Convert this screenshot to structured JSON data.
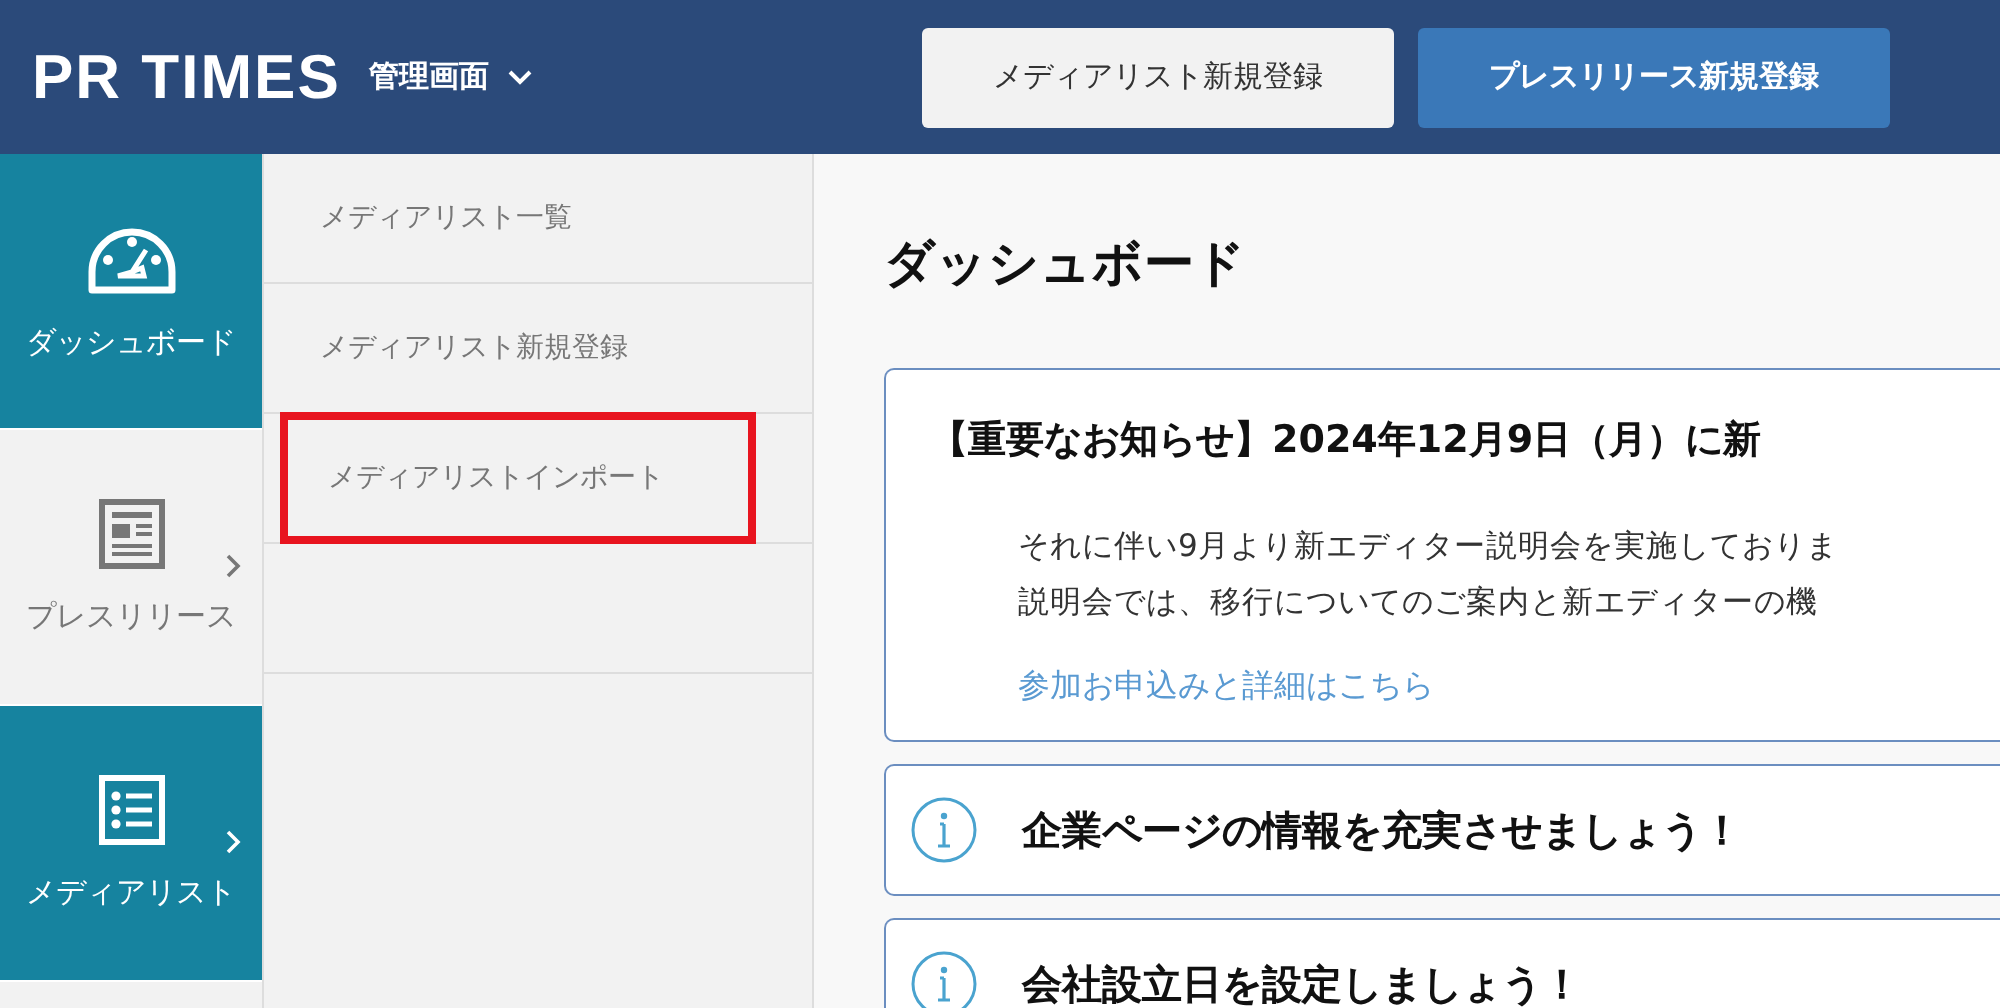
{
  "header": {
    "logo": "PR TIMES",
    "menu_label": "管理画面",
    "buttons": [
      {
        "label": "メディアリスト新規登録",
        "kind": "secondary"
      },
      {
        "label": "プレスリリース新規登録",
        "kind": "primary"
      }
    ]
  },
  "nav": [
    {
      "label": "ダッシュボード",
      "kind": "gauge",
      "selected": true,
      "has_submenu": false
    },
    {
      "label": "プレスリリース",
      "kind": "newspaper",
      "selected": false,
      "has_submenu": true
    },
    {
      "label": "メディアリスト",
      "kind": "list",
      "selected": true,
      "has_submenu": true
    }
  ],
  "submenu": [
    {
      "label": "メディアリスト一覧",
      "highlighted": false
    },
    {
      "label": "メディアリスト新規登録",
      "highlighted": false
    },
    {
      "label": "メディアリストインポート",
      "highlighted": true
    }
  ],
  "page_title": "ダッシュボード",
  "cards": [
    {
      "kind": "notice",
      "title": "【重要なお知らせ】2024年12月9日（月）に新",
      "lines": [
        "それに伴い9月より新エディター説明会を実施しておりま",
        "説明会では、移行についてのご案内と新エディターの機"
      ],
      "link": "参加お申込みと詳細はこちら"
    },
    {
      "kind": "info",
      "title": "企業ページの情報を充実させましょう！"
    },
    {
      "kind": "info",
      "title": "会社設立日を設定しましょう！"
    }
  ]
}
